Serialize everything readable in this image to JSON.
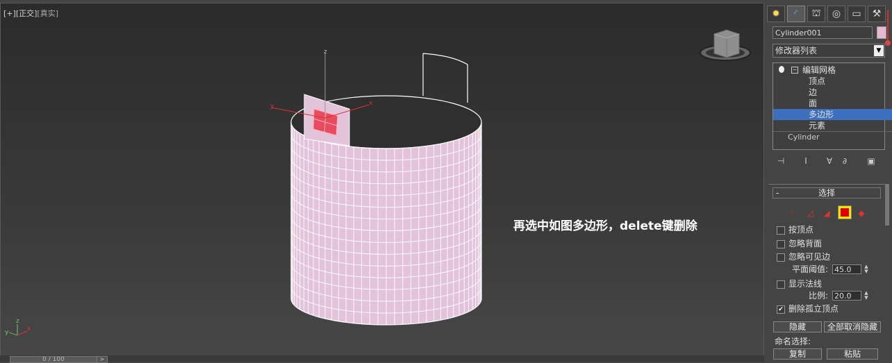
{
  "viewport": {
    "label_plus": "[+]",
    "label_view": "[正交]",
    "label_shade": "[真实]",
    "annotation": "再选中如图多边形，delete键删除",
    "axis_z": "z",
    "axis_x": "x",
    "axis_y": "y",
    "mini_x": "x",
    "mini_y": "y",
    "mini_z": "z"
  },
  "timeline": {
    "frame": "0 / 100",
    "next": ">"
  },
  "panel": {
    "tabs": [
      "create-tab",
      "modify-tab",
      "hierarchy-tab",
      "motion-tab",
      "display-tab",
      "utilities-tab"
    ],
    "object_name": "Cylinder001",
    "object_color": "#e6b8d4",
    "modifier_list": "修改器列表",
    "stack": {
      "root": "编辑网格",
      "subs": [
        "顶点",
        "边",
        "面",
        "多边形",
        "元素"
      ],
      "selected": "多边形",
      "base": "Cylinder"
    },
    "selection": {
      "title": "选择",
      "collapse": "-",
      "by_vertex": "按顶点",
      "ignore_backfaces": "忽略背面",
      "ignore_visible_edges": "忽略可见边",
      "planar_threshold_label": "平面阈值:",
      "planar_threshold_value": "45.0",
      "show_normals": "显示法线",
      "scale_label": "比例:",
      "scale_value": "20.0",
      "delete_isolated": "删除孤立顶点",
      "delete_isolated_checked": "✔",
      "hide": "隐藏",
      "unhide_all": "全部取消隐藏",
      "named_selection": "命名选择:",
      "copy": "复制",
      "paste": "粘贴"
    }
  }
}
